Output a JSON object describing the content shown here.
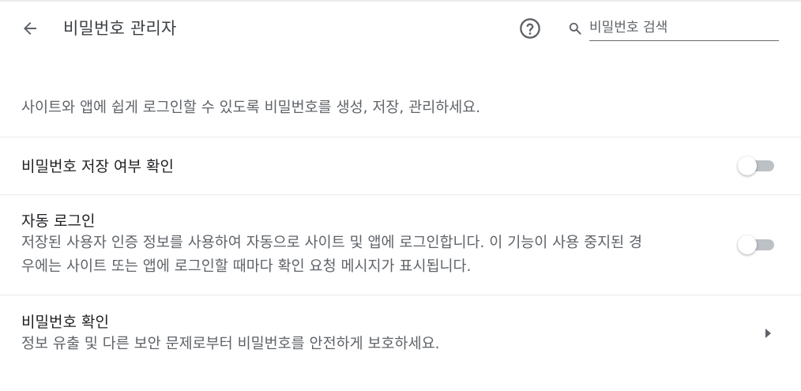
{
  "header": {
    "back_icon": "arrow-left-icon",
    "title": "비밀번호 관리자",
    "help_icon": "help-circle-icon",
    "search_icon": "search-icon",
    "search_placeholder": "비밀번호 검색",
    "search_value": ""
  },
  "description": "사이트와 앱에 쉽게 로그인할 수 있도록 비밀번호를 생성, 저장, 관리하세요.",
  "settings": {
    "offer_to_save": {
      "title": "비밀번호 저장 여부 확인",
      "enabled": false
    },
    "auto_signin": {
      "title": "자동 로그인",
      "description_line1": "저장된 사용자 인증 정보를 사용하여 자동으로 사이트 및 앱에 로그인합니다. 이 기능이 사용 중지된 경",
      "description_line2": "우에는 사이트 또는 앱에 로그인할 때마다 확인 요청 메시지가 표시됩니다.",
      "enabled": false
    },
    "password_checkup": {
      "title": "비밀번호 확인",
      "description": "정보 유출 및 다른 보안 문제로부터 비밀번호를 안전하게 보호하세요.",
      "arrow_icon": "triangle-right-icon"
    }
  },
  "colors": {
    "toggle_off_track": "#bdc1c6",
    "toggle_off_knob": "#ffffff",
    "divider": "#e8eaed",
    "secondary_text": "#5f6368"
  }
}
